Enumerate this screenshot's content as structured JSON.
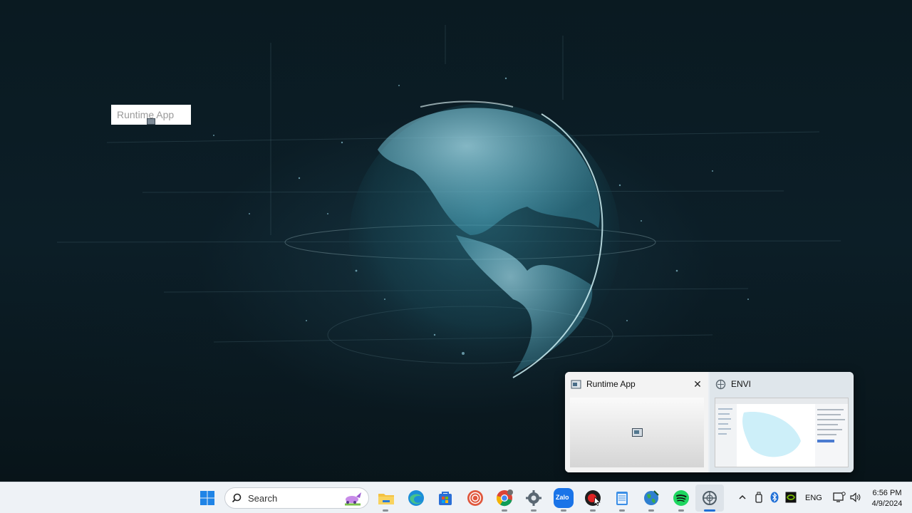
{
  "desktop": {
    "runtime_label": "Runtime App"
  },
  "taskbar_preview": {
    "items": [
      {
        "title": "Runtime App",
        "icon": "runtime-app-icon",
        "close": "✕"
      },
      {
        "title": "ENVI",
        "icon": "envi-icon"
      }
    ]
  },
  "taskbar": {
    "search_placeholder": "Search",
    "pinned_apps": [
      "start-icon",
      "file-explorer-icon",
      "edge-icon",
      "store-icon",
      "spiral-app-icon",
      "chrome-icon",
      "settings-icon",
      "zalo-icon",
      "recorder-icon",
      "notepad-icon",
      "earth-app-icon",
      "spotify-icon",
      "envi-icon"
    ],
    "zalo_label": "Zalo",
    "tray": {
      "language": "ENG",
      "time": "6:56 PM",
      "date": "4/9/2024"
    }
  },
  "colors": {
    "accent": "#1f6fd6",
    "taskbar_bg": "#eef2f6",
    "globe": "#6fd2e6"
  }
}
